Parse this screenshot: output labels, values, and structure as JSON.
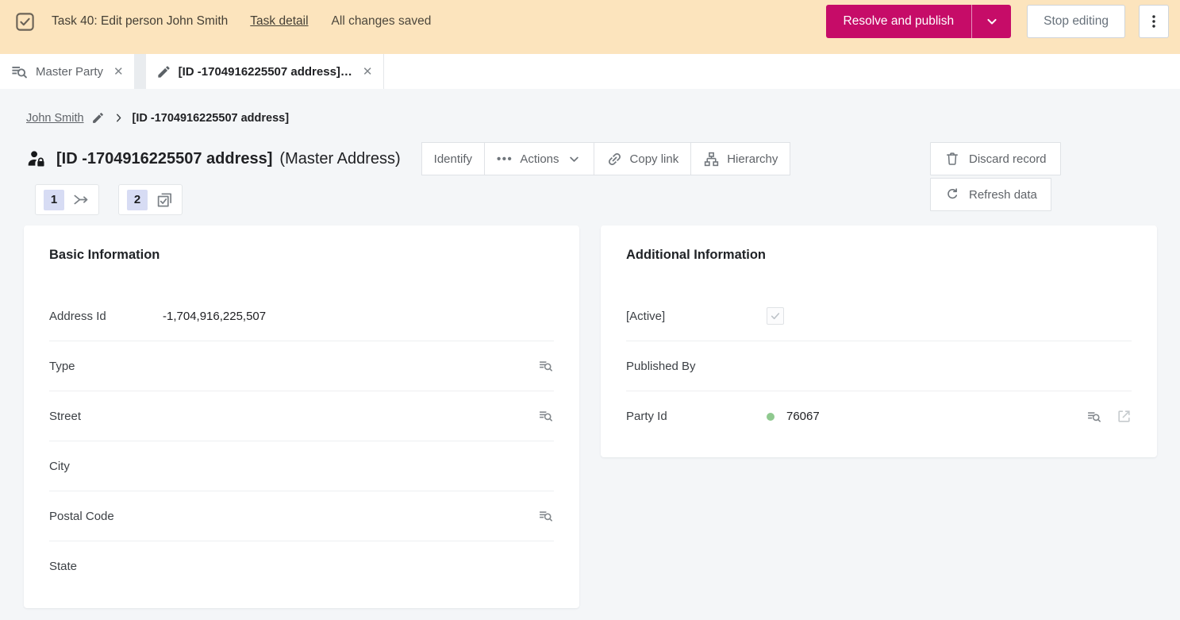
{
  "colors": {
    "accent": "#c60c68",
    "topbar_bg": "#fce4bd",
    "status_dot": "#8fc98f",
    "badge_chip": "#d7dcf4"
  },
  "topbar": {
    "task_label": "Task 40: Edit person John Smith",
    "task_detail": "Task detail",
    "saved_status": "All changes saved",
    "resolve_publish": "Resolve and publish",
    "stop_editing": "Stop editing"
  },
  "tabs": [
    {
      "label": "Master Party",
      "icon": "explore-eq-icon"
    },
    {
      "label": "[ID -1704916225507 address]…",
      "icon": "pencil-icon"
    }
  ],
  "breadcrumb": {
    "parent": "John Smith",
    "current": "[ID -1704916225507 address]"
  },
  "record": {
    "title": "[ID -1704916225507 address]",
    "type": "(Master Address)",
    "badges": [
      {
        "count": "1",
        "icon": "merge-icon"
      },
      {
        "count": "2",
        "icon": "stacked-check-icon"
      }
    ]
  },
  "actions": {
    "identify": "Identify",
    "actions_menu": "Actions",
    "copy_link": "Copy link",
    "hierarchy": "Hierarchy",
    "discard": "Discard record",
    "refresh": "Refresh data"
  },
  "cards": {
    "basic": {
      "title": "Basic Information",
      "rows": [
        {
          "label": "Address Id",
          "value": "-1,704,916,225,507"
        },
        {
          "label": "Type",
          "value": ""
        },
        {
          "label": "Street",
          "value": ""
        },
        {
          "label": "City",
          "value": ""
        },
        {
          "label": "Postal Code",
          "value": ""
        },
        {
          "label": "State",
          "value": ""
        }
      ]
    },
    "additional": {
      "title": "Additional Information",
      "rows": [
        {
          "label": "[Active]",
          "checked": true
        },
        {
          "label": "Published By",
          "value": ""
        },
        {
          "label": "Party Id",
          "value": "76067"
        }
      ]
    }
  }
}
